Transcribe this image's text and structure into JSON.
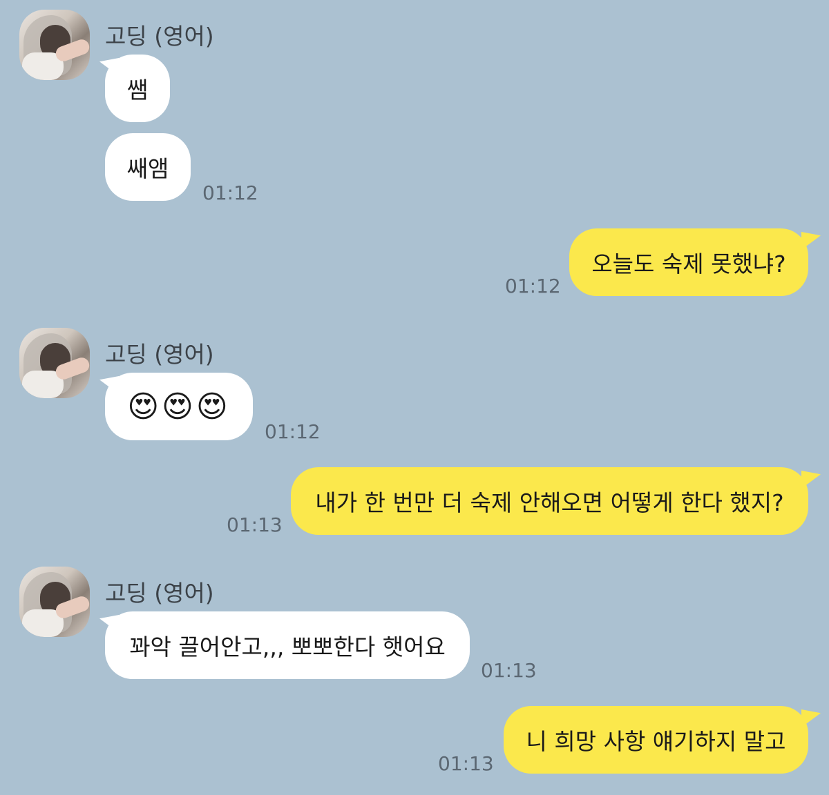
{
  "sender": {
    "name": "고딩 (영어)"
  },
  "messages": [
    {
      "id": "m1",
      "dir": "in",
      "text": "쌤",
      "time": ""
    },
    {
      "id": "m2",
      "dir": "in",
      "text": "쌔앰",
      "time": "01:12"
    },
    {
      "id": "m3",
      "dir": "out",
      "text": "오늘도 숙제 못했냐?",
      "time": "01:12"
    },
    {
      "id": "m4",
      "dir": "in",
      "text": "😍😍😍",
      "time": "01:12"
    },
    {
      "id": "m5",
      "dir": "out",
      "text": "내가 한 번만 더 숙제 안해오면 어떻게 한다 했지?",
      "time": "01:13"
    },
    {
      "id": "m6",
      "dir": "in",
      "text": "꽈악 끌어안고,,, 뽀뽀한다 햇어요",
      "time": "01:13"
    },
    {
      "id": "m7",
      "dir": "out",
      "text": "니 희망 사항 얘기하지 말고",
      "time": "01:13"
    }
  ],
  "colors": {
    "background": "#abc1d1",
    "incoming_bubble": "#ffffff",
    "outgoing_bubble": "#fbe84c",
    "timestamp": "#5b6772"
  },
  "icons": {
    "avatar": "profile-photo-avatar"
  }
}
